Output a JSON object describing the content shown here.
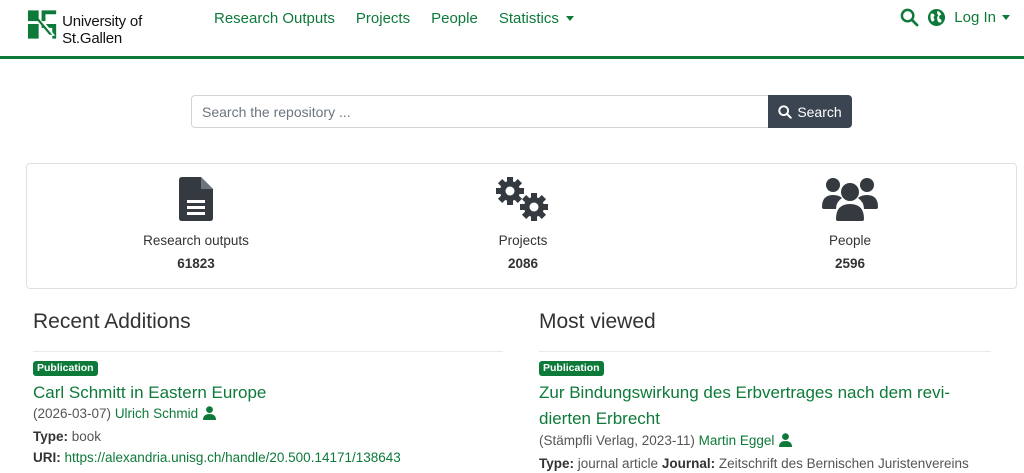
{
  "header": {
    "logo_text": "University of St.Gallen",
    "nav": [
      "Research Outputs",
      "Projects",
      "People",
      "Statistics"
    ],
    "login_label": "Log In",
    "accent_color": "#0d7a3a"
  },
  "search": {
    "placeholder": "Search the repository ...",
    "button_label": "Search"
  },
  "stats": [
    {
      "icon": "file-icon",
      "label": "Research outputs",
      "value": "61823"
    },
    {
      "icon": "gears-icon",
      "label": "Projects",
      "value": "2086"
    },
    {
      "icon": "users-icon",
      "label": "People",
      "value": "2596"
    }
  ],
  "recent": {
    "heading": "Recent Additions",
    "badge": "Publication",
    "title": "Carl Schmitt in Eastern Europe",
    "date": "(2026-03-07)",
    "author": "Ulrich Schmid",
    "type_label": "Type:",
    "type_value": "book",
    "uri_label": "URI:",
    "uri_value": "https://alexandria.unisg.ch/handle/20.500.14171/138643"
  },
  "viewed": {
    "heading": "Most viewed",
    "badge": "Publication",
    "title_line1": "Zur Bindungswirkung des Erbvertrages nach dem revi-",
    "title_line2": "dierten Erbrecht",
    "publisher": "(Stämpfli Verlag, 2023-11)",
    "author": "Martin Eggel",
    "type_label": "Type:",
    "type_value": "journal article",
    "journal_label": "Journal:",
    "journal_value": "Zeitschrift des Bernischen Juristenvereins"
  }
}
